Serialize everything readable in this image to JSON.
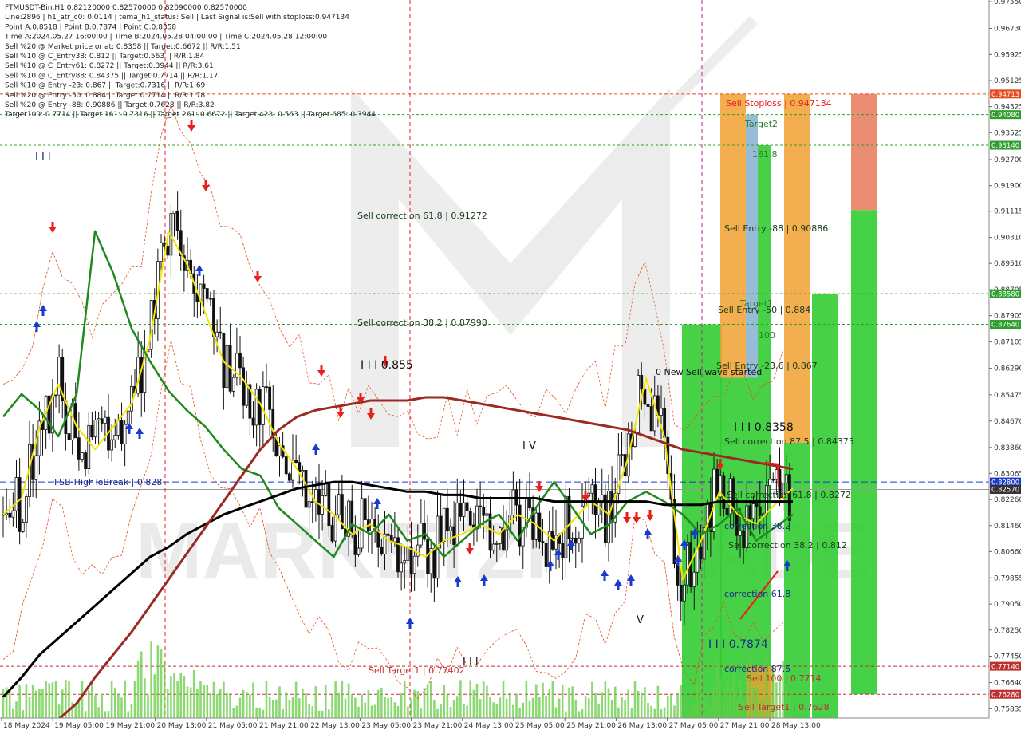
{
  "header": {
    "lines": [
      "FTMUSDT-Bin,H1  0.82120000 0.82570000 0.82090000 0.82570000",
      "Line:2896  |  h1_atr_c0: 0.0114  |  tema_h1_status: Sell  |  Last Signal is:Sell with stoploss:0.947134",
      "Point A:0.8518  |  Point B:0.7874  |  Point C:0.8358",
      "Time A:2024.05.27 16:00:00  |  Time B:2024.05.28 04:00:00  |  Time C:2024.05.28 12:00:00",
      "Sell %20 @ Market price or at: 0.8358  ||  Target:0.6672  ||  R/R:1.51",
      "Sell %10 @ C_Entry38: 0.812  ||  Target:0.563  ||  R/R:1.84",
      "Sell %10 @ C_Entry61: 0.8272  ||  Target:0.3944  ||  R/R:3.61",
      "Sell %10 @ C_Entry88: 0.84375  ||  Target:0.7714  ||  R/R:1.17",
      "Sell %10 @ Entry -23: 0.867  ||  Target:0.7316  ||  R/R:1.69",
      "Sell %20 @ Entry -50: 0.884  ||  Target:0.7714  ||  R/R:1.78",
      "Sell %20 @ Entry -88: 0.90886  ||  Target:0.7628  ||  R/R:3.82",
      "Target100: 0.7714  ||  Target 161: 0.7316  ||  Target 261: 0.6672  ||  Target 423: 0.563  ||  Target 685: 0.3944"
    ]
  },
  "price_axis": {
    "ticks": [
      "0.97550",
      "0.96730",
      "0.95925",
      "0.95125",
      "0.94325",
      "0.93525",
      "0.92700",
      "0.91900",
      "0.91115",
      "0.90310",
      "0.89510",
      "0.88705",
      "0.87905",
      "0.87105",
      "0.86290",
      "0.85475",
      "0.84670",
      "0.83860",
      "0.83065",
      "0.82260",
      "0.81460",
      "0.80660",
      "0.79855",
      "0.79050",
      "0.78250",
      "0.77450",
      "0.76640",
      "0.75835"
    ],
    "badges": [
      {
        "label": "0.94713",
        "price": 0.94713,
        "color": "#e8491d"
      },
      {
        "label": "0.94080",
        "price": 0.9408,
        "color": "#2e9e2e"
      },
      {
        "label": "0.93140",
        "price": 0.9314,
        "color": "#2e9e2e"
      },
      {
        "label": "0.88580",
        "price": 0.8858,
        "color": "#2e9e2e"
      },
      {
        "label": "0.87640",
        "price": 0.8764,
        "color": "#2e9e2e"
      },
      {
        "label": "0.82800",
        "price": 0.828,
        "color": "#1a3acc"
      },
      {
        "label": "0.82570",
        "price": 0.8257,
        "color": "#333333"
      },
      {
        "label": "0.77140",
        "price": 0.7714,
        "color": "#c03030"
      },
      {
        "label": "0.76280",
        "price": 0.7628,
        "color": "#c03030"
      }
    ]
  },
  "time_axis": {
    "ticks": [
      "18 May 2024",
      "19 May 05:00",
      "19 May 21:00",
      "20 May 13:00",
      "21 May 05:00",
      "21 May 21:00",
      "22 May 13:00",
      "23 May 05:00",
      "23 May 21:00",
      "24 May 13:00",
      "25 May 05:00",
      "25 May 21:00",
      "26 May 13:00",
      "27 May 05:00",
      "27 May 21:00",
      "28 May 13:00"
    ]
  },
  "annotations": {
    "sell_stoploss": "Sell Stoploss | 0.947134",
    "target2": "Target2",
    "t161": "161.8",
    "sell_entry_88": "Sell Entry -88 | 0.90886",
    "sell_correction_618_top": "Sell correction 61.8 | 0.91272",
    "target1": "Target1",
    "sell_entry_50": "Sell Entry -50 | 0.884",
    "t100": "100",
    "sell_correction_382_top": "Sell correction 38.2 | 0.87998",
    "sell_entry_236": "Sell Entry -23.6 | 0.867",
    "new_sell_wave": "0 New Sell wave started",
    "label_0855": "I I I 0.855",
    "label_08358": "I I I 0.8358",
    "sell_correction_875": "Sell correction 87.5 | 0.84375",
    "wave_iv": "I V",
    "fsb_high": "FSB-HighToBreak | 0.828",
    "sell_correction_618": "Sell correction 61.8 | 0.8272",
    "correction_382": "correction 38.2",
    "sell_correction_382": "Sell correction 38.2 | 0.812",
    "correction_618": "correction 61.8",
    "wave_v": "V",
    "label_07874": "I I I 0.7874",
    "correction_875": "correction 87.5",
    "sell_target1": "Sell Target1 | 0.77402",
    "sell_100": "Sell 100 | 0.7714",
    "sell_target1_b": "Sell Target1 | 0.7628",
    "wave_iii": "I I I",
    "wave_iii_top": "I I I"
  },
  "chart_data": {
    "type": "line",
    "title": "FTMUSDT-Bin,H1",
    "ylim": [
      0.7555,
      0.976
    ],
    "series": [
      {
        "values": [
          0.818,
          0.823,
          0.845,
          0.858,
          0.845,
          0.838,
          0.845,
          0.852,
          0.872,
          0.905,
          0.895,
          0.88,
          0.865,
          0.86,
          0.852,
          0.84,
          0.832,
          0.822,
          0.818,
          0.812,
          0.815,
          0.81,
          0.808,
          0.805,
          0.81,
          0.812,
          0.815,
          0.812,
          0.818,
          0.815,
          0.81,
          0.816,
          0.822,
          0.818,
          0.835,
          0.86,
          0.842,
          0.798,
          0.81,
          0.825,
          0.818,
          0.815,
          0.821,
          0.826
        ]
      },
      {
        "values": [
          0.848,
          0.855,
          0.85,
          0.842,
          0.855,
          0.905,
          0.892,
          0.875,
          0.865,
          0.856,
          0.85,
          0.845,
          0.838,
          0.832,
          0.83,
          0.82,
          0.815,
          0.81,
          0.805,
          0.815,
          0.812,
          0.818,
          0.81,
          0.812,
          0.805,
          0.81,
          0.815,
          0.818,
          0.81,
          0.82,
          0.828,
          0.82,
          0.812,
          0.815,
          0.822,
          0.825,
          0.822,
          0.818,
          0.812,
          0.815,
          0.82,
          0.81,
          0.814,
          0.818
        ]
      },
      {
        "values": [
          0.762,
          0.768,
          0.775,
          0.78,
          0.785,
          0.79,
          0.795,
          0.8,
          0.805,
          0.808,
          0.812,
          0.815,
          0.818,
          0.82,
          0.822,
          0.824,
          0.826,
          0.827,
          0.828,
          0.828,
          0.827,
          0.826,
          0.825,
          0.825,
          0.824,
          0.824,
          0.823,
          0.823,
          0.823,
          0.823,
          0.822,
          0.822,
          0.822,
          0.822,
          0.822,
          0.822,
          0.821,
          0.821,
          0.821,
          0.822,
          0.822,
          0.822,
          0.822,
          0.822
        ]
      },
      {
        "values": [
          0.74,
          0.745,
          0.75,
          0.755,
          0.76,
          0.768,
          0.775,
          0.782,
          0.79,
          0.798,
          0.806,
          0.814,
          0.822,
          0.83,
          0.838,
          0.844,
          0.848,
          0.85,
          0.851,
          0.852,
          0.853,
          0.853,
          0.853,
          0.854,
          0.854,
          0.853,
          0.852,
          0.851,
          0.85,
          0.849,
          0.848,
          0.847,
          0.846,
          0.845,
          0.844,
          0.842,
          0.84,
          0.838,
          0.837,
          0.836,
          0.835,
          0.834,
          0.833,
          0.832
        ]
      }
    ]
  }
}
